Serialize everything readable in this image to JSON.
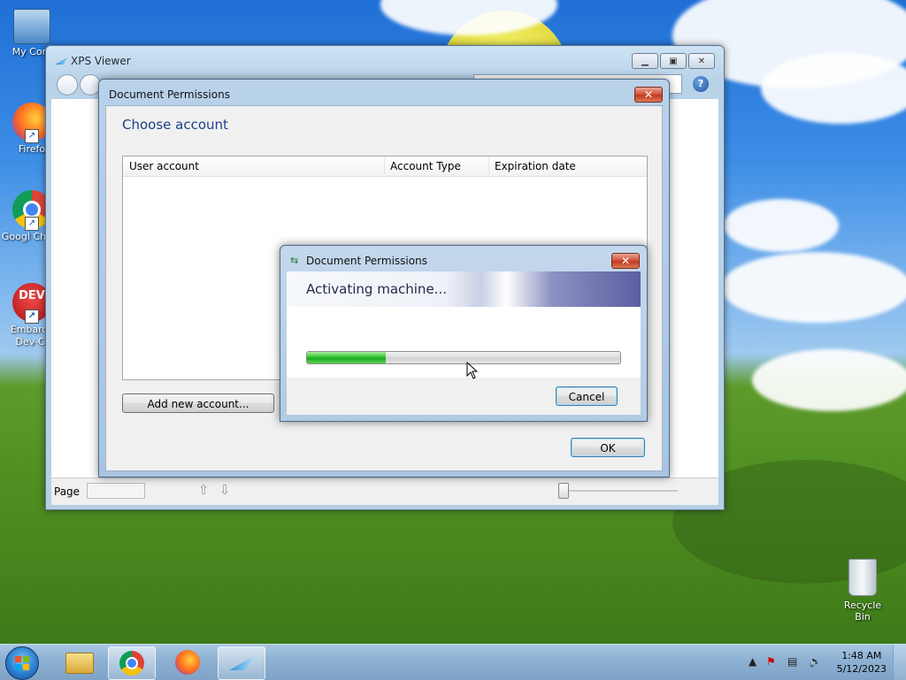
{
  "desktop": {
    "icons": [
      {
        "label": "My Com"
      },
      {
        "label": "Firefo"
      },
      {
        "label": "Googl Chron"
      },
      {
        "label": "Embarca Dev-C-"
      }
    ],
    "recycle_bin": "Recycle Bin"
  },
  "xps_viewer": {
    "title": "XPS Viewer",
    "status": {
      "page_label": "Page"
    }
  },
  "permissions_dialog": {
    "title": "Document Permissions",
    "heading": "Choose account",
    "columns": [
      "User account",
      "Account Type",
      "Expiration date"
    ],
    "add_button": "Add new account...",
    "ok_button": "OK"
  },
  "activating_dialog": {
    "title": "Document Permissions",
    "message": "Activating machine...",
    "progress_percent": 25,
    "cancel_button": "Cancel"
  },
  "taskbar": {
    "time": "1:48 AM",
    "date": "5/12/2023",
    "apps": [
      "windows-explorer",
      "google-chrome",
      "firefox",
      "xps-viewer"
    ]
  },
  "colors": {
    "accent_title": "#1e3e8a",
    "progress_green": "#16ae1d",
    "close_red": "#c13b22"
  }
}
